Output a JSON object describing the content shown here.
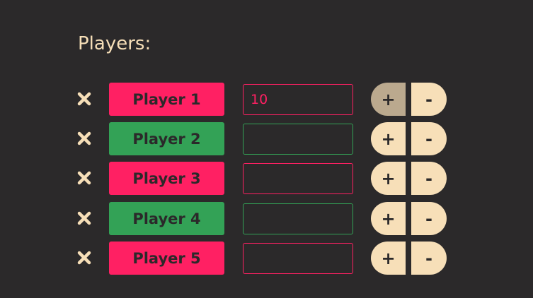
{
  "header": {
    "title": "Players:"
  },
  "colors": {
    "background": "#2b292a",
    "cream": "#f7dfb8",
    "cream_pressed": "#bba98e",
    "pink": "#ff2063",
    "green": "#33a256"
  },
  "players": [
    {
      "name": "Player 1",
      "color": "pink",
      "score": "10",
      "plus_pressed": true
    },
    {
      "name": "Player 2",
      "color": "green",
      "score": "",
      "plus_pressed": false
    },
    {
      "name": "Player 3",
      "color": "pink",
      "score": "",
      "plus_pressed": false
    },
    {
      "name": "Player 4",
      "color": "green",
      "score": "",
      "plus_pressed": false
    },
    {
      "name": "Player 5",
      "color": "pink",
      "score": "",
      "plus_pressed": false
    }
  ],
  "controls": {
    "remove_icon": "close-icon",
    "plus_label": "+",
    "minus_label": "-"
  }
}
